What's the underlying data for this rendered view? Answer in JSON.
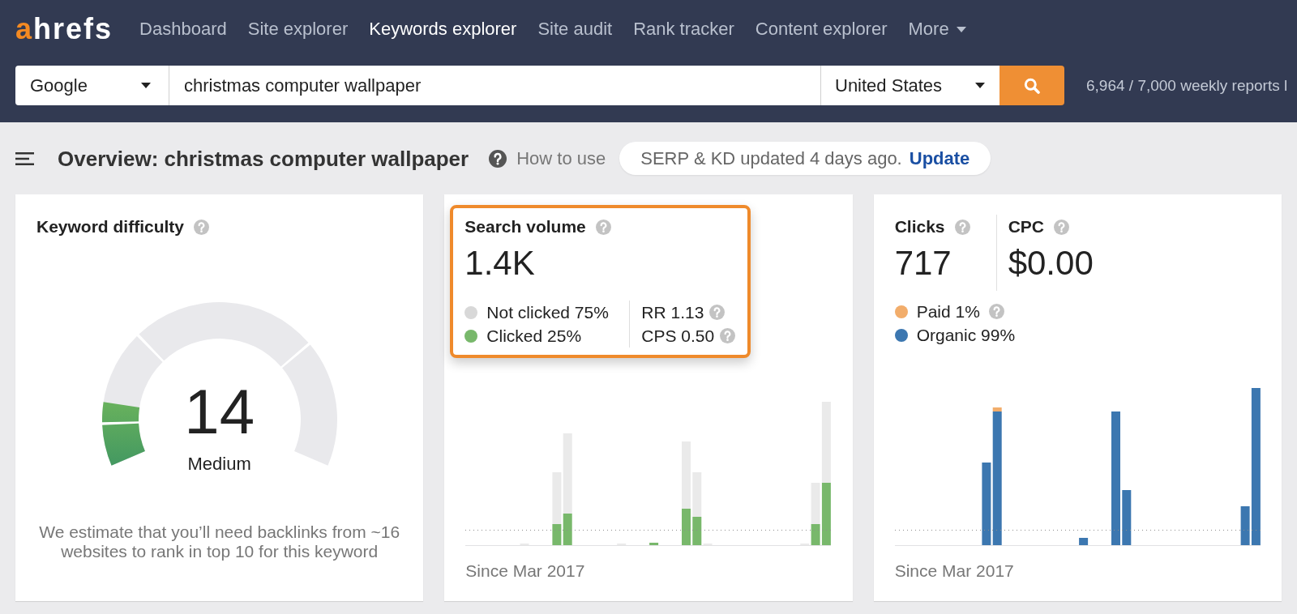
{
  "top_bar": {
    "logo": {
      "accent": "a",
      "rest": "hrefs"
    },
    "nav": [
      {
        "label": "Dashboard",
        "kind": "link",
        "selected": false
      },
      {
        "label": "Site explorer",
        "kind": "link",
        "selected": false
      },
      {
        "label": "Keywords explorer",
        "kind": "link",
        "selected": true
      },
      {
        "label": "Site audit",
        "kind": "link",
        "selected": false
      },
      {
        "label": "Rank tracker",
        "kind": "link",
        "selected": false
      },
      {
        "label": "Content explorer",
        "kind": "link",
        "selected": false
      },
      {
        "label": "More",
        "kind": "menu",
        "selected": false
      }
    ]
  },
  "search_bar": {
    "engine": "Google",
    "query": "christmas computer wallpaper",
    "country": "United States",
    "quota": "6,964 / 7,000 weekly reports l"
  },
  "overview": {
    "title": "Overview: christmas computer wallpaper",
    "help_link": "How to use",
    "notice": "SERP & KD updated 4 days ago.",
    "notice_action": "Update"
  },
  "keyword_difficulty": {
    "title": "Keyword difficulty",
    "score": "14",
    "level": 0.14,
    "rating": "Medium",
    "note": "We estimate that you’ll need backlinks from ~16 websites to rank in top 10 for this keyword"
  },
  "search_volume": {
    "highlighted": true,
    "title": "Search volume",
    "value": "1.4K",
    "legend": [
      {
        "label": "Not clicked 75%",
        "color": "#d8d8d8"
      },
      {
        "label": "Clicked 25%",
        "color": "#78b86b"
      }
    ],
    "metrics": [
      "RR 1.13",
      "CPS 0.50"
    ],
    "footer": "Since Mar 2017"
  },
  "clicks": {
    "metrics": [
      {
        "title": "Clicks",
        "value": "717"
      },
      {
        "title": "CPC",
        "value": "$0.00"
      }
    ],
    "legend": [
      {
        "label": "Paid 1%",
        "color": "#f2ad6b",
        "help": true
      },
      {
        "label": "Organic 99%",
        "color": "#3c77b0",
        "help": false
      }
    ],
    "footer": "Since Mar 2017"
  }
}
